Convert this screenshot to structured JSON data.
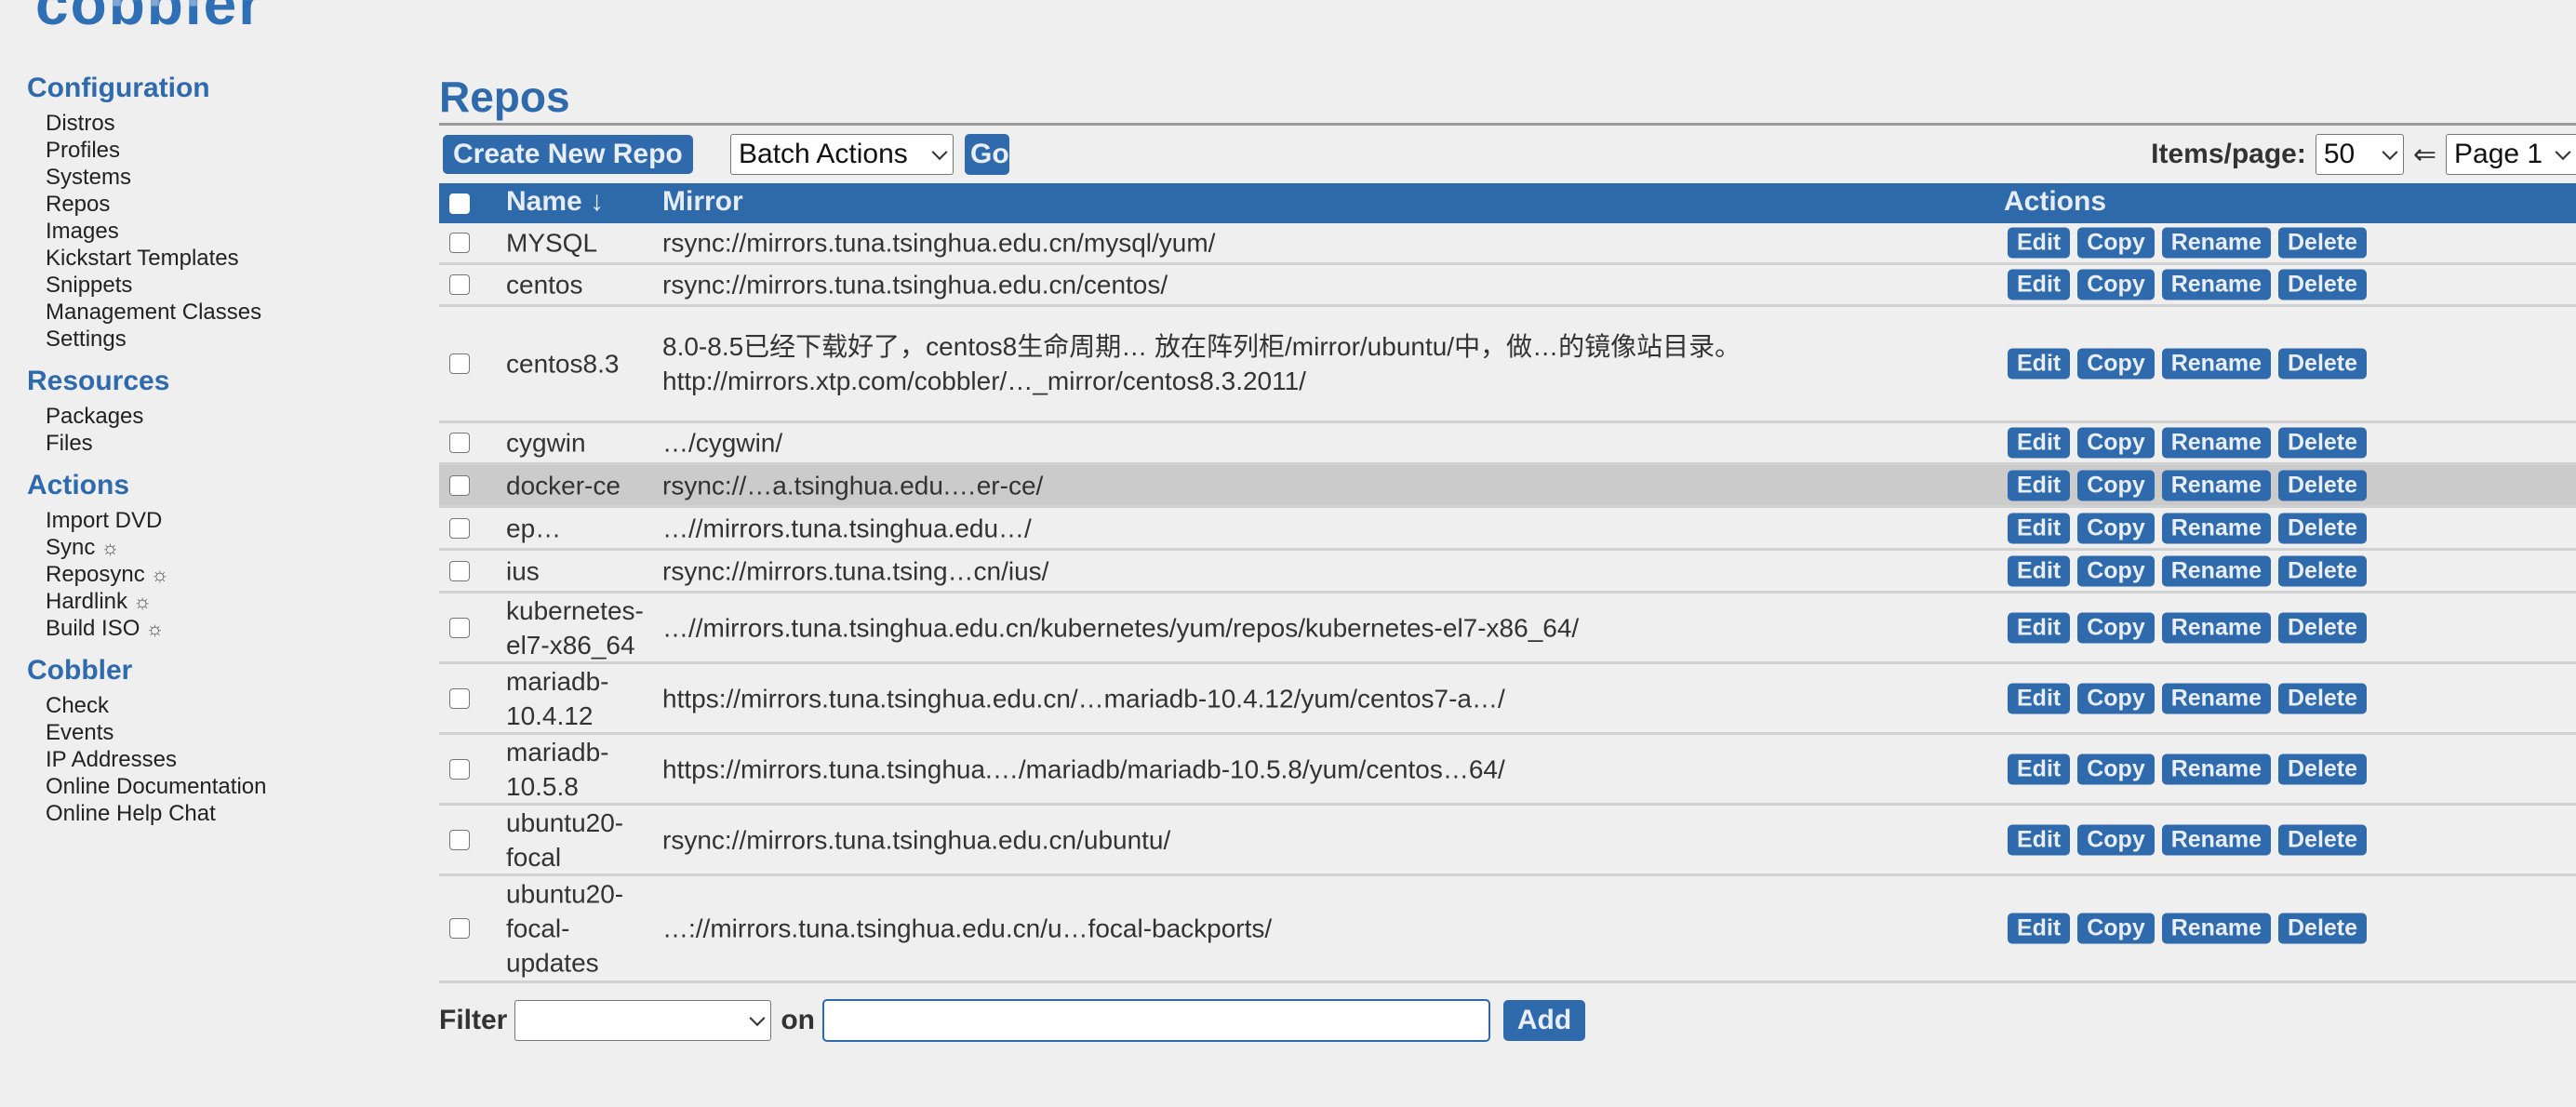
{
  "logo": {
    "text": "cobbler"
  },
  "sidebar": {
    "sections": [
      {
        "heading": "Configuration",
        "items": [
          {
            "label": "Distros"
          },
          {
            "label": "Profiles"
          },
          {
            "label": "Systems"
          },
          {
            "label": "Repos"
          },
          {
            "label": "Images"
          },
          {
            "label": "Kickstart Templates"
          },
          {
            "label": "Snippets"
          },
          {
            "label": "Management Classes"
          },
          {
            "label": "Settings"
          }
        ]
      },
      {
        "heading": "Resources",
        "items": [
          {
            "label": "Packages"
          },
          {
            "label": "Files"
          }
        ]
      },
      {
        "heading": "Actions",
        "items": [
          {
            "label": "Import DVD"
          },
          {
            "label": "Sync",
            "icon": "☼"
          },
          {
            "label": "Reposync",
            "icon": "☼"
          },
          {
            "label": "Hardlink",
            "icon": "☼"
          },
          {
            "label": "Build ISO",
            "icon": "☼"
          }
        ]
      },
      {
        "heading": "Cobbler",
        "items": [
          {
            "label": "Check"
          },
          {
            "label": "Events"
          },
          {
            "label": "IP Addresses"
          },
          {
            "label": "Online Documentation"
          },
          {
            "label": "Online Help Chat"
          }
        ]
      }
    ]
  },
  "main": {
    "title": "Repos",
    "toolbar": {
      "create_label": "Create New Repo",
      "batch_actions": "Batch Actions",
      "go_label": "Go",
      "items_per_page_label": "Items/page:",
      "items_per_page": "50",
      "prev_arrow": "⇐",
      "page": "Page 1"
    },
    "table": {
      "columns": {
        "name": "Name ↓",
        "mirror": "Mirror",
        "actions": "Actions"
      },
      "action_labels": {
        "edit": "Edit",
        "copy": "Copy",
        "rename": "Rename",
        "delete": "Delete"
      },
      "rows": [
        {
          "name": "MYSQL",
          "mirror": "rsync://mirrors.tuna.tsinghua.edu.cn/mysql/yum/"
        },
        {
          "name": "centos",
          "mirror": "rsync://mirrors.tuna.tsinghua.edu.cn/centos/"
        },
        {
          "name": "centos8.3",
          "mirror": "8.0-8.5已经下载好了，centos8生命周期… 放在阵列柜/mirror/ubuntu/中，做…的镜像站目录。 http://mirrors.xtp.com/cobbler/…_mirror/centos8.3.2011/"
        },
        {
          "name": "cygwin",
          "mirror": "…/cygwin/"
        },
        {
          "name": "docker-ce",
          "mirror": "rsync://…a.tsinghua.edu.…er-ce/",
          "hover": true
        },
        {
          "name": "ep…",
          "mirror": "…//mirrors.tuna.tsinghua.edu…/"
        },
        {
          "name": "ius",
          "mirror": "rsync://mirrors.tuna.tsing…cn/ius/"
        },
        {
          "name": "kubernetes-el7-x86_64",
          "mirror": "…//mirrors.tuna.tsinghua.edu.cn/kubernetes/yum/repos/kubernetes-el7-x86_64/"
        },
        {
          "name": "mariadb-10.4.12",
          "mirror": "https://mirrors.tuna.tsinghua.edu.cn/…mariadb-10.4.12/yum/centos7-a…/"
        },
        {
          "name": "mariadb-10.5.8",
          "mirror": "https://mirrors.tuna.tsinghua.…/mariadb/mariadb-10.5.8/yum/centos…64/"
        },
        {
          "name": "ubuntu20-focal",
          "mirror": "rsync://mirrors.tuna.tsinghua.edu.cn/ubuntu/"
        },
        {
          "name": "ubuntu20-focal-updates",
          "mirror": "…://mirrors.tuna.tsinghua.edu.cn/u…focal-backports/"
        }
      ]
    },
    "filter": {
      "label": "Filter",
      "on_label": "on",
      "field_value": "",
      "value": "",
      "add_label": "Add"
    }
  },
  "colors": {
    "accent": "#2e69aa",
    "background": "#efefef",
    "row_hover": "#cbcbcb"
  }
}
